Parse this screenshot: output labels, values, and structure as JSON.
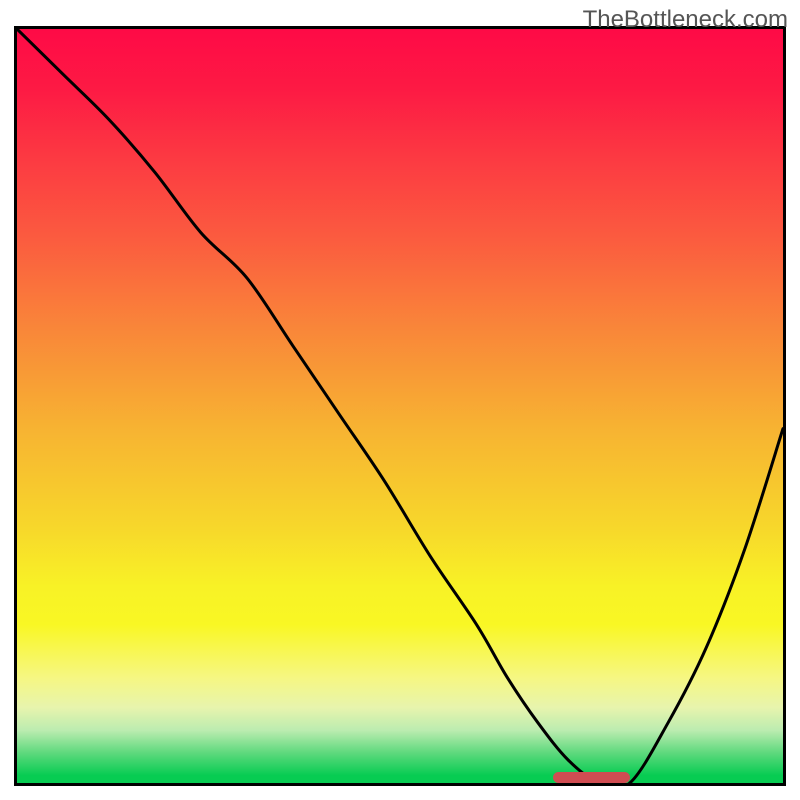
{
  "watermark": "TheBottleneck.com",
  "colors": {
    "curve": "#000000",
    "marker": "#d04d52"
  },
  "chart_data": {
    "type": "line",
    "title": "",
    "xlabel": "",
    "ylabel": "",
    "xlim": [
      0,
      100
    ],
    "ylim": [
      0,
      100
    ],
    "gradient_stops": [
      {
        "pct": 0,
        "hex": "#fe0a46"
      },
      {
        "pct": 8,
        "hex": "#fd1a44"
      },
      {
        "pct": 17,
        "hex": "#fc3942"
      },
      {
        "pct": 28,
        "hex": "#fb5c3f"
      },
      {
        "pct": 40,
        "hex": "#f98739"
      },
      {
        "pct": 53,
        "hex": "#f7b332"
      },
      {
        "pct": 66,
        "hex": "#f7d72b"
      },
      {
        "pct": 74,
        "hex": "#f8f226"
      },
      {
        "pct": 79,
        "hex": "#f9f724"
      },
      {
        "pct": 86,
        "hex": "#f6f782"
      },
      {
        "pct": 90,
        "hex": "#e7f4ad"
      },
      {
        "pct": 93,
        "hex": "#bcecb0"
      },
      {
        "pct": 96,
        "hex": "#5ed97d"
      },
      {
        "pct": 99,
        "hex": "#07cc52"
      }
    ],
    "x": [
      0,
      6,
      12,
      18,
      24,
      30,
      36,
      42,
      48,
      54,
      60,
      64,
      68,
      72,
      76,
      80,
      85,
      90,
      95,
      100
    ],
    "values": [
      100,
      94,
      88,
      81,
      73,
      67,
      58,
      49,
      40,
      30,
      21,
      14,
      8,
      3,
      0,
      0,
      8,
      18,
      31,
      47
    ],
    "note": "x and values are in 0–100 chart-space percentages; curve reaches minimum ≈0 between x≈72 and x≈80, then rises again.",
    "marker": {
      "x_start": 70,
      "x_end": 80,
      "y": 0
    }
  }
}
